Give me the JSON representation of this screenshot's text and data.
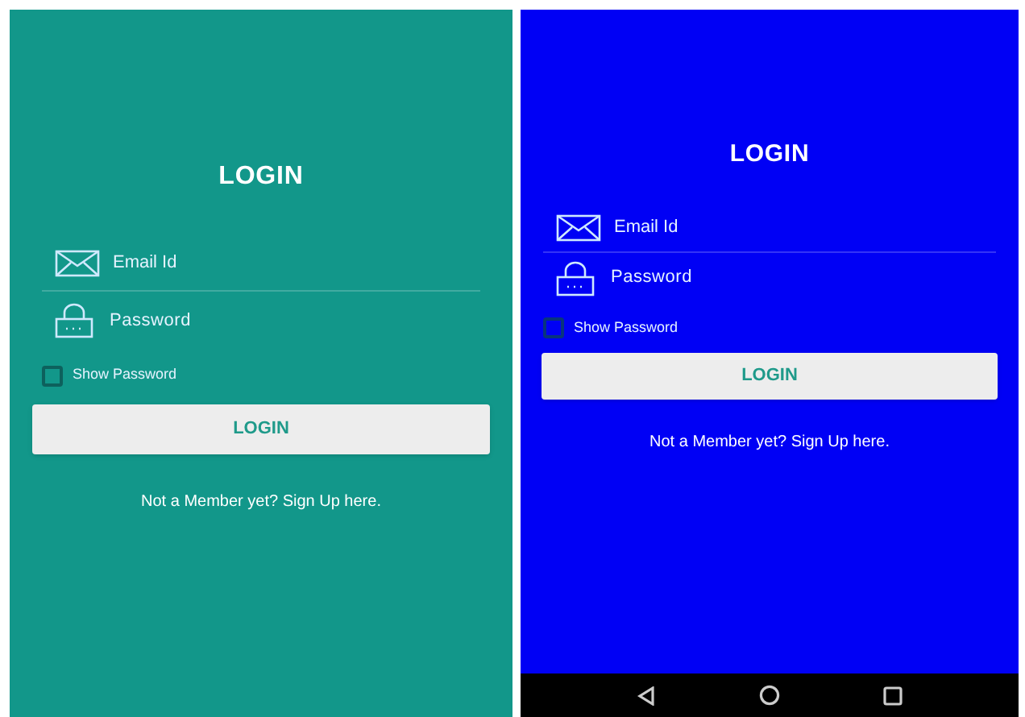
{
  "screens": [
    {
      "color": "#12978a",
      "title": "LOGIN",
      "email": {
        "placeholder": "Email Id"
      },
      "password": {
        "placeholder": "Password"
      },
      "show_password": {
        "label": "Show Password",
        "checked": false
      },
      "button": "LOGIN",
      "signup_link": "Not a Member yet? Sign Up here.",
      "nav_bar": false
    },
    {
      "color": "#0000f5",
      "title": "LOGIN",
      "email": {
        "placeholder": "Email Id"
      },
      "password": {
        "placeholder": "Password"
      },
      "show_password": {
        "label": "Show Password",
        "checked": false
      },
      "button": "LOGIN",
      "signup_link": "Not a Member yet? Sign Up here.",
      "nav_bar": true
    }
  ]
}
